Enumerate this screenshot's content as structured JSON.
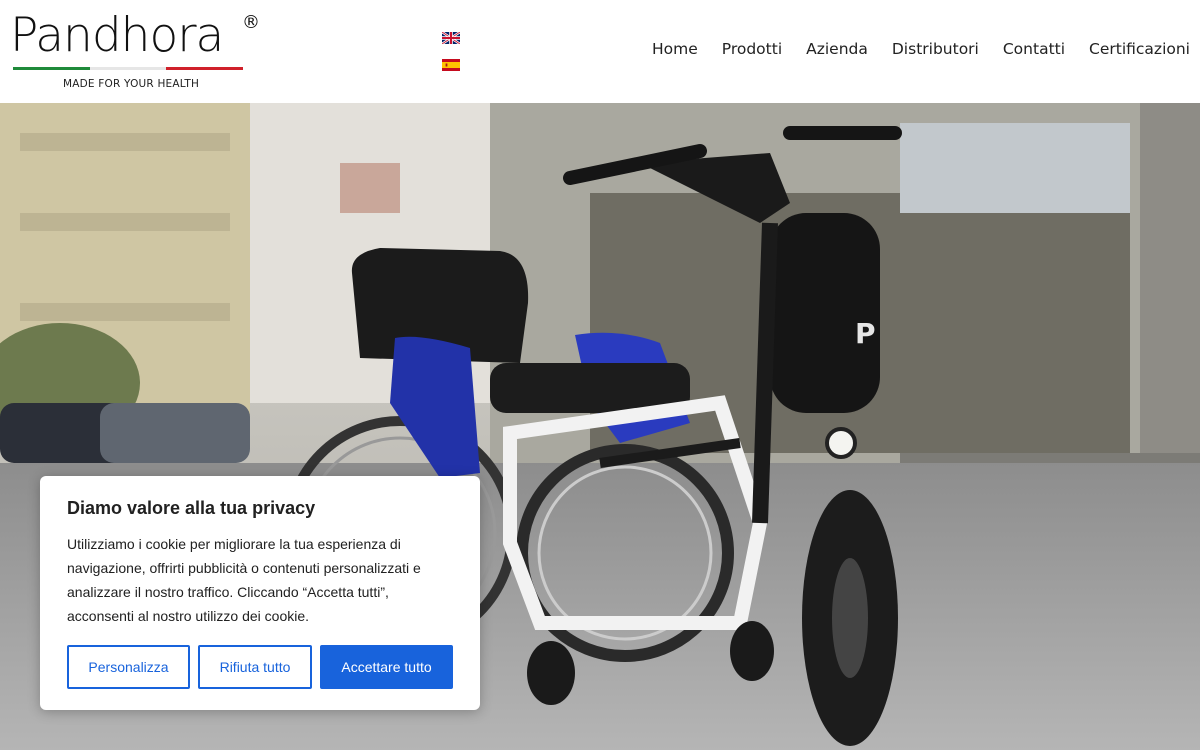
{
  "brand": {
    "name": "Pandhora",
    "registered": "®",
    "tagline": "MADE FOR YOUR HEALTH",
    "stripe_colors": [
      "#1f8a3a",
      "#ffffff",
      "#d0202a"
    ]
  },
  "languages": [
    {
      "code": "en",
      "icon": "uk-flag-icon"
    },
    {
      "code": "es",
      "icon": "spain-flag-icon"
    }
  ],
  "nav": {
    "items": [
      "Home",
      "Prodotti",
      "Azienda",
      "Distributori",
      "Contatti",
      "Certificazioni"
    ]
  },
  "hero": {
    "description_icon": "wheelchair-ebike-attachment-photo",
    "device_label": "P"
  },
  "cookie": {
    "title": "Diamo valore alla tua privacy",
    "body": "Utilizziamo i cookie per migliorare la tua esperienza di navigazione, offrirti pubblicità o contenuti personalizzati e analizzare il nostro traffico. Cliccando “Accetta tutti”, acconsenti al nostro utilizzo dei cookie.",
    "customize_label": "Personalizza",
    "reject_label": "Rifiuta tutto",
    "accept_label": "Accettare tutto",
    "accent_color": "#1863dc"
  }
}
